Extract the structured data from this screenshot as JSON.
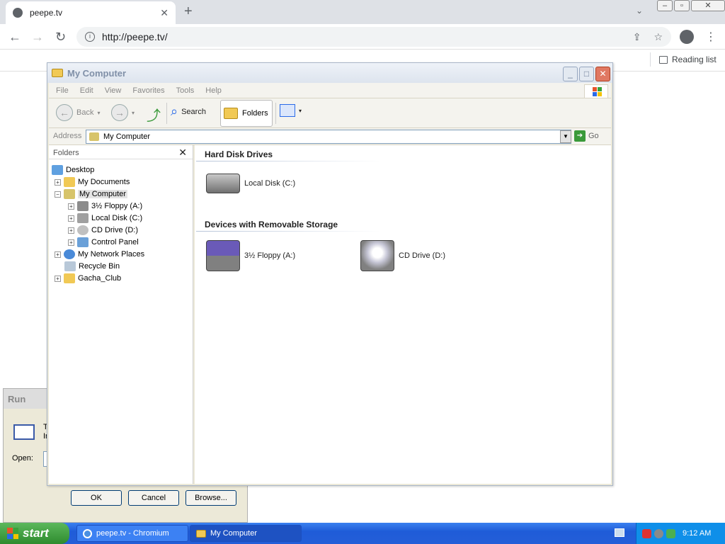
{
  "browser": {
    "tab_title": "peepe.tv",
    "url": "http://peepe.tv/",
    "reading_list": "Reading list"
  },
  "run": {
    "title": "Run",
    "text_line1": "T",
    "text_line2": "Ir",
    "open_label": "Open:",
    "ok": "OK",
    "cancel": "Cancel",
    "browse": "Browse..."
  },
  "mycomputer": {
    "title": "My Computer",
    "menu": [
      "File",
      "Edit",
      "View",
      "Favorites",
      "Tools",
      "Help"
    ],
    "toolbar": {
      "back": "Back",
      "search": "Search",
      "folders": "Folders"
    },
    "address_label": "Address",
    "address_value": "My Computer",
    "go": "Go",
    "folders_header": "Folders",
    "tree": [
      {
        "label": "Desktop"
      },
      {
        "label": "My Documents"
      },
      {
        "label": "My Computer"
      },
      {
        "label": "3½ Floppy (A:)"
      },
      {
        "label": "Local Disk (C:)"
      },
      {
        "label": "CD Drive (D:)"
      },
      {
        "label": "Control Panel"
      },
      {
        "label": "My Network Places"
      },
      {
        "label": "Recycle Bin"
      },
      {
        "label": "Gacha_Club"
      }
    ],
    "sections": {
      "hdd": "Hard Disk Drives",
      "removable": "Devices with Removable Storage"
    },
    "devices": {
      "local_disk": "Local Disk (C:)",
      "floppy": "3½ Floppy (A:)",
      "cd": "CD Drive (D:)"
    }
  },
  "taskbar": {
    "start": "start",
    "tasks": [
      "peepe.tv - Chromium",
      "My Computer"
    ],
    "clock": "9:12 AM"
  }
}
